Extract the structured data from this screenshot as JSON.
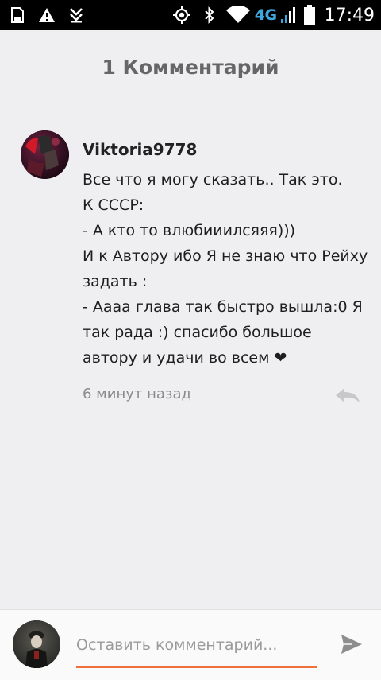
{
  "status_bar": {
    "network_type": "4G",
    "time": "17:49",
    "icons": [
      "sd-card-icon",
      "warning-icon",
      "download-icon",
      "location-icon",
      "bluetooth-icon",
      "wifi-icon",
      "signal-icon",
      "battery-icon"
    ]
  },
  "header": {
    "title": "1 Комментарий"
  },
  "comment": {
    "author": "Viktoria9778",
    "lines": [
      "Все что я могу сказать.. Так это.",
      "К СССР:",
      "- А кто то влюбииилсяяя)))",
      "И к Автору ибо Я не знаю что Рейху",
      "задать :",
      "- Аааа глава так быстро вышла:0 Я",
      "так рада :) спасибо большое",
      "автору и удачи во всем ❤"
    ],
    "time": "6 минут назад",
    "reply_icon": "reply-icon"
  },
  "composer": {
    "placeholder": "Оставить комментарий...",
    "value": "",
    "send_icon": "send-icon",
    "accent_color": "#f0703a"
  }
}
